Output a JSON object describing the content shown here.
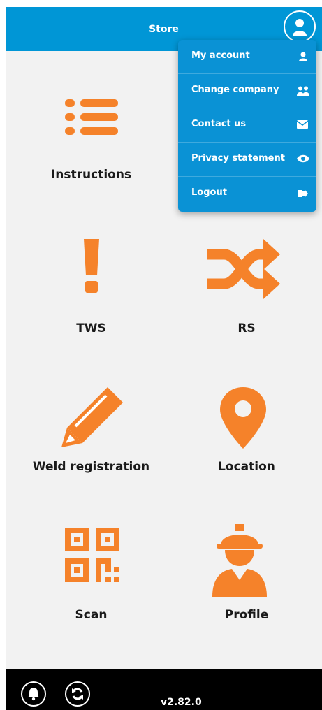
{
  "header": {
    "title": "Store"
  },
  "tiles": {
    "instructions": "Instructions",
    "tws": "TWS",
    "rs": "RS",
    "weld_registration": "Weld registration",
    "location": "Location",
    "scan": "Scan",
    "profile": "Profile"
  },
  "menu": {
    "items": [
      {
        "label": "My account",
        "icon": "user-icon"
      },
      {
        "label": "Change company",
        "icon": "users-icon"
      },
      {
        "label": "Contact us",
        "icon": "envelope-icon"
      },
      {
        "label": "Privacy statement",
        "icon": "eye-icon"
      },
      {
        "label": "Logout",
        "icon": "logout-icon"
      }
    ]
  },
  "footer": {
    "version": "v2.82.0"
  },
  "colors": {
    "accent": "#0096d6",
    "icon_orange": "#f5822a",
    "footer_bg": "#000000",
    "background": "#f2f2f2"
  }
}
